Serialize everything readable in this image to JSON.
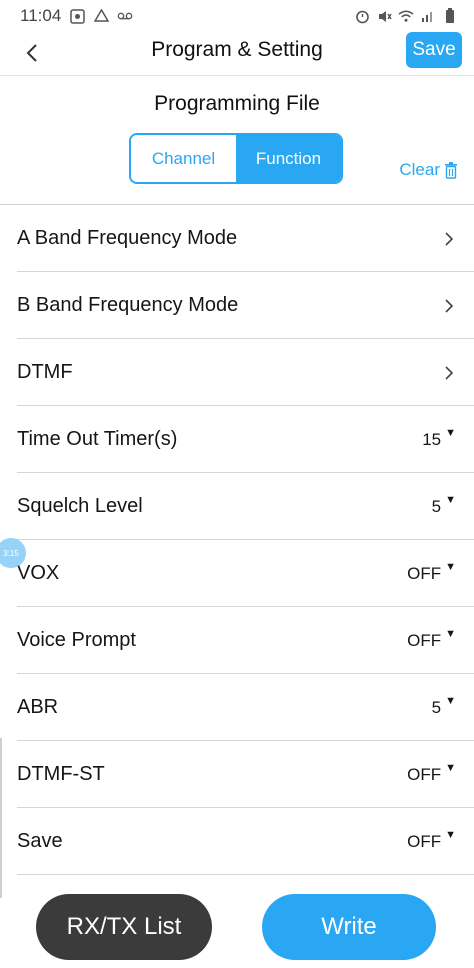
{
  "status_bar": {
    "time": "11:04",
    "icons_left": [
      "screenshot-icon",
      "drive-icon",
      "voicemail-icon"
    ],
    "icons_right": [
      "alarm-icon",
      "mute-icon",
      "wifi-icon",
      "signal-icon",
      "battery-icon"
    ]
  },
  "header": {
    "title": "Program & Setting",
    "save_label": "Save"
  },
  "section": {
    "title": "Programming File",
    "tabs": [
      {
        "label": "Channel",
        "active": false
      },
      {
        "label": "Function",
        "active": true
      }
    ],
    "clear_label": "Clear"
  },
  "settings": [
    {
      "label": "A Band Frequency Mode",
      "value": "",
      "control": "chevron"
    },
    {
      "label": "B Band Frequency Mode",
      "value": "",
      "control": "chevron"
    },
    {
      "label": "DTMF",
      "value": "",
      "control": "chevron"
    },
    {
      "label": "Time Out Timer(s)",
      "value": "15",
      "control": "dropdown"
    },
    {
      "label": "Squelch Level",
      "value": "5",
      "control": "dropdown"
    },
    {
      "label": "VOX",
      "value": "OFF",
      "control": "dropdown"
    },
    {
      "label": "Voice Prompt",
      "value": "OFF",
      "control": "dropdown"
    },
    {
      "label": "ABR",
      "value": "5",
      "control": "dropdown"
    },
    {
      "label": "DTMF-ST",
      "value": "OFF",
      "control": "dropdown"
    },
    {
      "label": "Save",
      "value": "OFF",
      "control": "dropdown"
    }
  ],
  "floating_bubble": "3:15",
  "bottom": {
    "rx_tx_label": "RX/TX List",
    "write_label": "Write"
  },
  "colors": {
    "accent": "#2aa7f2",
    "dark_button": "#3b3b3b"
  }
}
